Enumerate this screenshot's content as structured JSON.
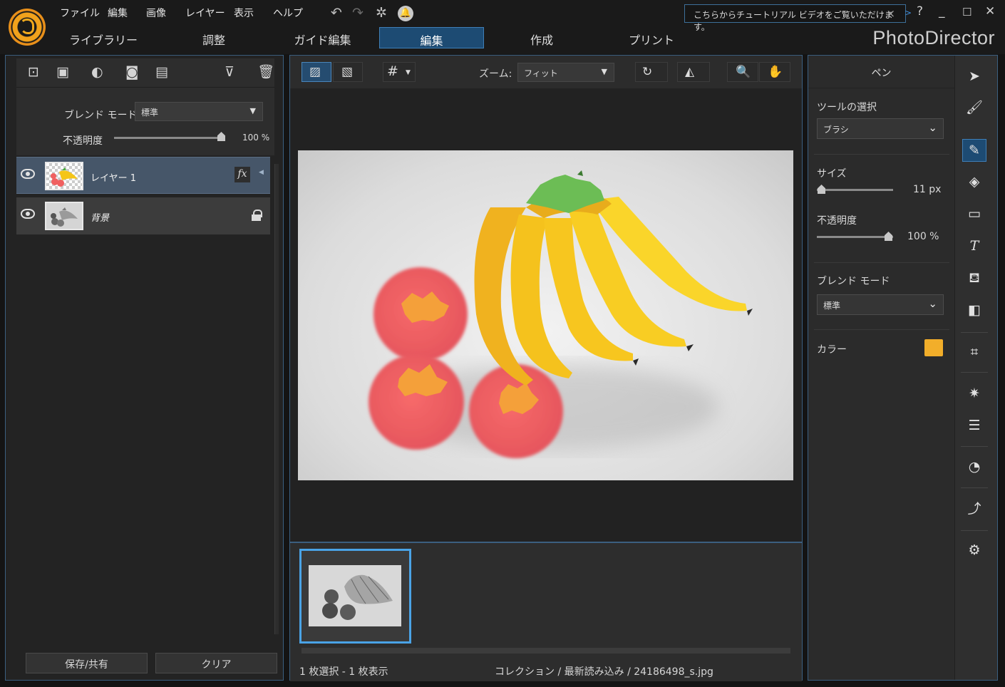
{
  "menubar": {
    "items": [
      "ファイル",
      "編集",
      "画像",
      "レイヤー",
      "表示",
      "ヘルプ"
    ],
    "tutorial_text": "こちらからチュートリアル ビデオをご覧いただけます。",
    "help": "?"
  },
  "nav": {
    "tabs": [
      "ライブラリー",
      "調整",
      "ガイド編集",
      "編集",
      "作成",
      "プリント"
    ],
    "active": "編集",
    "brand": "PhotoDirector"
  },
  "layers_panel": {
    "blend_mode_label": "ブレンド モード:",
    "blend_mode_value": "標準",
    "opacity_label": "不透明度",
    "opacity_value": "100 %",
    "opacity_fraction": 1.0,
    "layers": [
      {
        "name": "レイヤー 1",
        "selected": true,
        "fx": "fx"
      },
      {
        "name": "背景",
        "locked": true
      }
    ],
    "save_share": "保存/共有",
    "clear": "クリア"
  },
  "canvas": {
    "zoom_label": "ズーム:",
    "zoom_value": "フィット"
  },
  "status": {
    "selection": "1 枚選択 - 1 枚表示",
    "path": "コレクション / 最新読み込み / 24186498_s.jpg"
  },
  "pen_panel": {
    "title": "ペン",
    "tool_select_label": "ツールの選択",
    "tool_select_value": "ブラシ",
    "size_label": "サイズ",
    "size_value": "11 px",
    "opacity_label": "不透明度",
    "opacity_value": "100 %",
    "blend_mode_label": "ブレンド モード",
    "blend_mode_value": "標準",
    "color_label": "カラー",
    "color_hex": "#f2ae2a"
  },
  "colors": {
    "accent": "#3f7fb7",
    "active_bg": "#1d4b73",
    "selection_border": "#4aa3e6"
  }
}
